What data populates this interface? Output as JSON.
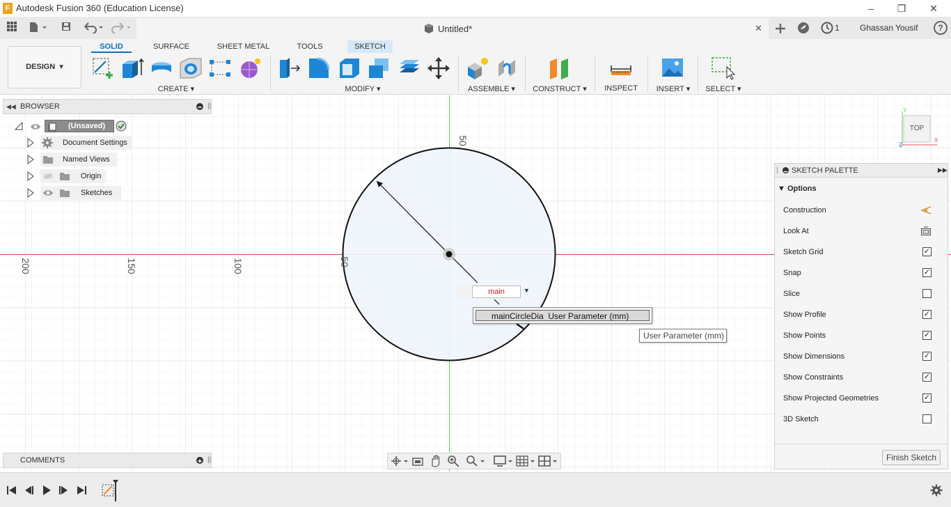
{
  "window": {
    "title": "Autodesk Fusion 360 (Education License)",
    "logo_letter": "F",
    "minimize": "–",
    "restore": "❐",
    "close": "✕"
  },
  "document_tab": {
    "title": "Untitled*",
    "close": "✕",
    "job_count": "1",
    "user_name": "Ghassan Yousif",
    "help": "?"
  },
  "ribbon": {
    "workspace": "DESIGN",
    "tabs": [
      "SOLID",
      "SURFACE",
      "SHEET METAL",
      "TOOLS",
      "SKETCH"
    ],
    "active_tab": "SOLID",
    "groups": [
      "CREATE",
      "MODIFY",
      "ASSEMBLE",
      "CONSTRUCT",
      "INSPECT",
      "INSERT",
      "SELECT"
    ]
  },
  "browser": {
    "header": "BROWSER",
    "root": "(Unsaved)",
    "items": [
      "Document Settings",
      "Named Views",
      "Origin",
      "Sketches"
    ]
  },
  "comments": {
    "header": "COMMENTS"
  },
  "viewcube": {
    "face": "TOP",
    "axis_x": "X",
    "axis_y": "Y",
    "axis_z": "Z"
  },
  "canvas": {
    "ruler_labels_x": [
      "200",
      "150",
      "100",
      "50"
    ],
    "ruler_label_y": "50",
    "accent_red": "#e05050",
    "accent_green": "#5ccf5c"
  },
  "dimension": {
    "input_value": "main",
    "suggestion_name": "mainCircleDia",
    "suggestion_type": "User Parameter (mm)",
    "tooltip": "User Parameter (mm)"
  },
  "sketch_palette": {
    "title": "SKETCH PALETTE",
    "section": "Options",
    "options": [
      {
        "label": "Construction",
        "kind": "icon",
        "icon": "construction-icon"
      },
      {
        "label": "Look At",
        "kind": "icon",
        "icon": "look-at-icon"
      },
      {
        "label": "Sketch Grid",
        "kind": "check",
        "checked": true
      },
      {
        "label": "Snap",
        "kind": "check",
        "checked": true
      },
      {
        "label": "Slice",
        "kind": "check",
        "checked": false
      },
      {
        "label": "Show Profile",
        "kind": "check",
        "checked": true
      },
      {
        "label": "Show Points",
        "kind": "check",
        "checked": true
      },
      {
        "label": "Show Dimensions",
        "kind": "check",
        "checked": true
      },
      {
        "label": "Show Constraints",
        "kind": "check",
        "checked": true
      },
      {
        "label": "Show Projected Geometries",
        "kind": "check",
        "checked": true
      },
      {
        "label": "3D Sketch",
        "kind": "check",
        "checked": false
      }
    ],
    "finish_button": "Finish Sketch"
  }
}
